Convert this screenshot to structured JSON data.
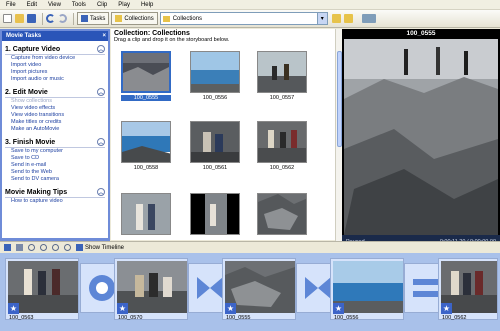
{
  "menu": [
    "File",
    "Edit",
    "View",
    "Tools",
    "Clip",
    "Play",
    "Help"
  ],
  "toolbar": {
    "tasks_label": "Tasks",
    "collections_label": "Collections",
    "collection_combo_value": "Collections"
  },
  "tasks_pane": {
    "title": "Movie Tasks",
    "sections": [
      {
        "number": "1.",
        "heading": "Capture Video",
        "links": [
          "Capture from video device",
          "Import video",
          "Import pictures",
          "Import audio or music"
        ]
      },
      {
        "number": "2.",
        "heading": "Edit Movie",
        "links": [
          "Show collections",
          "View video effects",
          "View video transitions",
          "Make titles or credits",
          "Make an AutoMovie"
        ]
      },
      {
        "number": "3.",
        "heading": "Finish Movie",
        "links": [
          "Save to my computer",
          "Save to CD",
          "Send in e-mail",
          "Send to the Web",
          "Send to DV camera"
        ]
      },
      {
        "number": "",
        "heading": "Movie Making Tips",
        "links": [
          "How to capture video"
        ]
      }
    ]
  },
  "collection": {
    "title": "Collection: Collections",
    "subtitle": "Drag a clip and drop it on the storyboard below.",
    "clips": [
      {
        "label": "100_0555",
        "selected": true
      },
      {
        "label": "100_0556",
        "selected": false
      },
      {
        "label": "100_0557",
        "selected": false
      },
      {
        "label": "100_0558",
        "selected": false
      },
      {
        "label": "100_0561",
        "selected": false
      },
      {
        "label": "100_0562",
        "selected": false
      },
      {
        "label": "",
        "selected": false
      },
      {
        "label": "",
        "selected": false
      },
      {
        "label": "",
        "selected": false
      }
    ]
  },
  "player": {
    "title": "100_0555",
    "status": "Paused",
    "time": "0:00:11.20 / 0:00:00.00"
  },
  "storyboard_toolbar": {
    "show_timeline_label": "Show Timeline"
  },
  "storyboard": {
    "clips": [
      "100_0563",
      "100_0570",
      "100_0555",
      "100_0556",
      "100_0562"
    ]
  },
  "colors": {
    "task_pane_blue": "#6f8cd8",
    "storyboard_blue": "#a9c1ea",
    "selection_blue": "#316ac5"
  }
}
